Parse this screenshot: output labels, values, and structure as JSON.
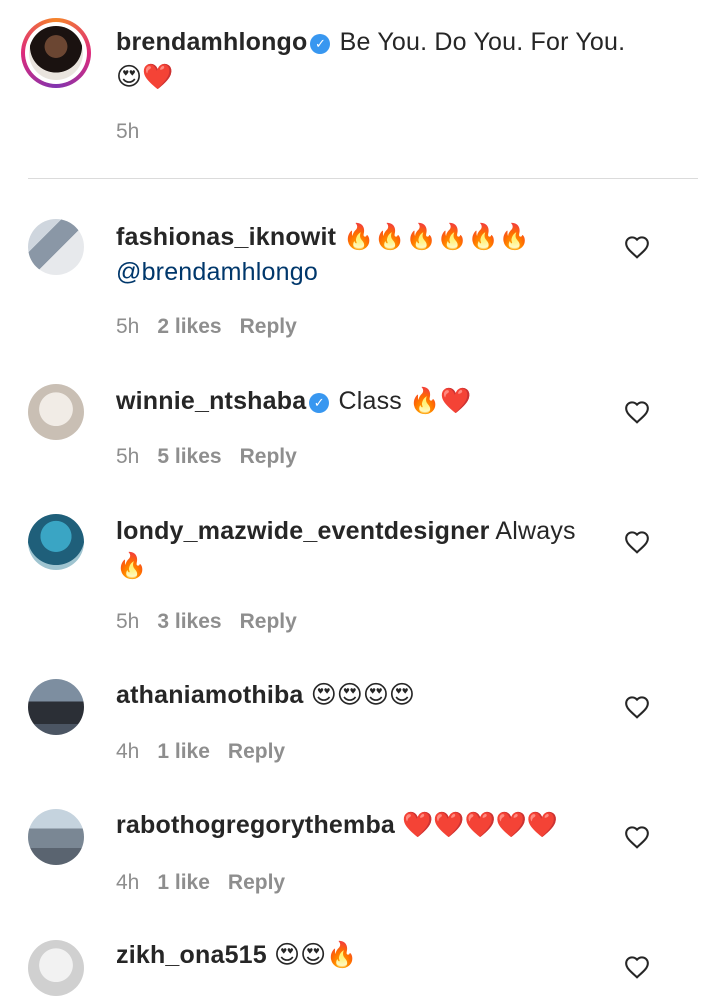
{
  "caption": {
    "username": "brendamhlongo",
    "text": "Be You. Do You. For You.",
    "emoji": "😍❤️",
    "time": "5h"
  },
  "comments": [
    {
      "username": "fashionas_iknowit",
      "verified": false,
      "text": "",
      "emoji": "🔥🔥🔥🔥🔥🔥",
      "mention": "@brendamhlongo",
      "time": "5h",
      "likes": "2 likes",
      "reply": "Reply"
    },
    {
      "username": "winnie_ntshaba",
      "verified": true,
      "text": "Class",
      "emoji": "🔥❤️",
      "time": "5h",
      "likes": "5 likes",
      "reply": "Reply"
    },
    {
      "username": "londy_mazwide_eventdesigner",
      "verified": false,
      "text": "Always",
      "emoji": "🔥",
      "time": "5h",
      "likes": "3 likes",
      "reply": "Reply"
    },
    {
      "username": "athaniamothiba",
      "verified": false,
      "text": "",
      "emoji": "😍😍😍😍",
      "time": "4h",
      "likes": "1 like",
      "reply": "Reply"
    },
    {
      "username": "rabothogregorythemba",
      "verified": false,
      "text": "",
      "emoji": "❤️❤️❤️❤️❤️",
      "time": "4h",
      "likes": "1 like",
      "reply": "Reply"
    },
    {
      "username": "zikh_ona515",
      "verified": false,
      "text": "",
      "emoji": "😍😍🔥"
    }
  ],
  "icons": {
    "verified": "✓",
    "like": "heart-outline-icon"
  },
  "colors": {
    "verified": "#3897f0",
    "mention": "#00376b",
    "meta": "#8e8e8e",
    "text": "#262626"
  }
}
